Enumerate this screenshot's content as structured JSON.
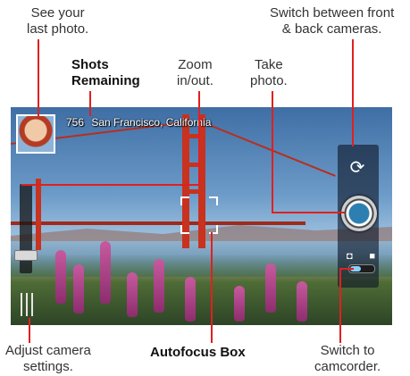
{
  "callouts": {
    "last_photo": [
      "See your",
      "last photo."
    ],
    "switch_cameras": [
      "Switch between front",
      "& back cameras."
    ],
    "shots_remaining": [
      "Shots",
      "Remaining"
    ],
    "zoom": [
      "Zoom",
      "in/out."
    ],
    "take_photo": [
      "Take",
      "photo."
    ],
    "adjust_settings": [
      "Adjust camera",
      "settings."
    ],
    "autofocus": "Autofocus Box",
    "camcorder": [
      "Switch to",
      "camcorder."
    ]
  },
  "status": {
    "shots_remaining": "756",
    "location": "San Francisco, California"
  },
  "icons": {
    "switch_camera": "switch-camera-icon",
    "shutter": "shutter-icon",
    "camera": "camera-icon",
    "video": "video-camera-icon",
    "settings": "settings-icon"
  },
  "camera_mode": "photo",
  "colors": {
    "leader": "#e02020",
    "shutter_blue": "#2e7fb1",
    "toggle_accent": "#8ad0ff"
  }
}
